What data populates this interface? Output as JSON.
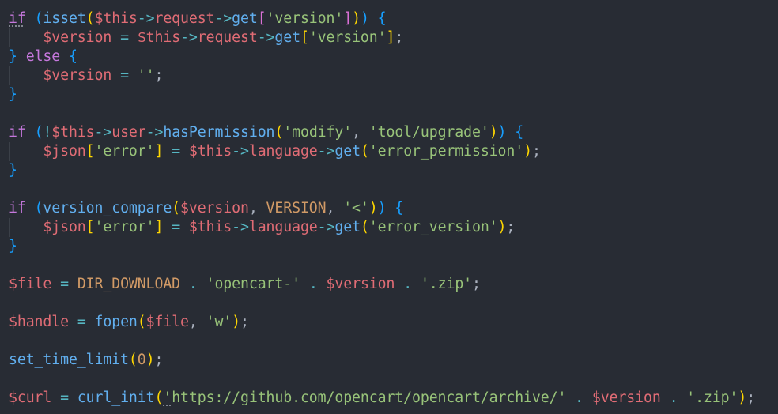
{
  "editor": {
    "language": "php",
    "theme": "dark",
    "colors": {
      "background": "#282c34",
      "keyword": "#c678dd",
      "function": "#61afef",
      "variable": "#e06c75",
      "string": "#98c379",
      "constant": "#d19a66",
      "operator": "#56b6c2",
      "punctuation": "#abb2bf",
      "bracket_level1": "#ffd700",
      "bracket_level2": "#da70d6",
      "bracket_level3": "#179fff"
    },
    "lines": [
      [
        {
          "t": "if",
          "c": "keyword",
          "sq": true
        },
        {
          "t": " ",
          "c": "punct"
        },
        {
          "t": "(",
          "c": "bracket3"
        },
        {
          "t": "isset",
          "c": "function"
        },
        {
          "t": "(",
          "c": "bracket1"
        },
        {
          "t": "$this",
          "c": "variable"
        },
        {
          "t": "->",
          "c": "operator"
        },
        {
          "t": "request",
          "c": "variable"
        },
        {
          "t": "->",
          "c": "operator"
        },
        {
          "t": "get",
          "c": "function"
        },
        {
          "t": "[",
          "c": "bracket2"
        },
        {
          "t": "'version'",
          "c": "string"
        },
        {
          "t": "]",
          "c": "bracket2"
        },
        {
          "t": ")",
          "c": "bracket1"
        },
        {
          "t": ")",
          "c": "bracket3"
        },
        {
          "t": " ",
          "c": "punct"
        },
        {
          "t": "{",
          "c": "bracket3"
        }
      ],
      [
        {
          "t": "    ",
          "c": "punct"
        },
        {
          "t": "$version",
          "c": "variable"
        },
        {
          "t": " ",
          "c": "punct"
        },
        {
          "t": "=",
          "c": "operator"
        },
        {
          "t": " ",
          "c": "punct"
        },
        {
          "t": "$this",
          "c": "variable"
        },
        {
          "t": "->",
          "c": "operator"
        },
        {
          "t": "request",
          "c": "variable"
        },
        {
          "t": "->",
          "c": "operator"
        },
        {
          "t": "get",
          "c": "function"
        },
        {
          "t": "[",
          "c": "bracket1"
        },
        {
          "t": "'version'",
          "c": "string"
        },
        {
          "t": "]",
          "c": "bracket1"
        },
        {
          "t": ";",
          "c": "punct"
        }
      ],
      [
        {
          "t": "}",
          "c": "bracket3"
        },
        {
          "t": " ",
          "c": "punct"
        },
        {
          "t": "else",
          "c": "keyword"
        },
        {
          "t": " ",
          "c": "punct"
        },
        {
          "t": "{",
          "c": "bracket3"
        }
      ],
      [
        {
          "t": "    ",
          "c": "punct"
        },
        {
          "t": "$version",
          "c": "variable"
        },
        {
          "t": " ",
          "c": "punct"
        },
        {
          "t": "=",
          "c": "operator"
        },
        {
          "t": " ",
          "c": "punct"
        },
        {
          "t": "''",
          "c": "string"
        },
        {
          "t": ";",
          "c": "punct"
        }
      ],
      [
        {
          "t": "}",
          "c": "bracket3"
        }
      ],
      [],
      [
        {
          "t": "if",
          "c": "keyword"
        },
        {
          "t": " ",
          "c": "punct"
        },
        {
          "t": "(",
          "c": "bracket3"
        },
        {
          "t": "!",
          "c": "operator"
        },
        {
          "t": "$this",
          "c": "variable"
        },
        {
          "t": "->",
          "c": "operator"
        },
        {
          "t": "user",
          "c": "variable"
        },
        {
          "t": "->",
          "c": "operator"
        },
        {
          "t": "hasPermission",
          "c": "function"
        },
        {
          "t": "(",
          "c": "bracket1"
        },
        {
          "t": "'modify'",
          "c": "string"
        },
        {
          "t": ", ",
          "c": "punct"
        },
        {
          "t": "'tool/upgrade'",
          "c": "string"
        },
        {
          "t": ")",
          "c": "bracket1"
        },
        {
          "t": ")",
          "c": "bracket3"
        },
        {
          "t": " ",
          "c": "punct"
        },
        {
          "t": "{",
          "c": "bracket3"
        }
      ],
      [
        {
          "t": "    ",
          "c": "punct"
        },
        {
          "t": "$json",
          "c": "variable"
        },
        {
          "t": "[",
          "c": "bracket1"
        },
        {
          "t": "'error'",
          "c": "string"
        },
        {
          "t": "]",
          "c": "bracket1"
        },
        {
          "t": " ",
          "c": "punct"
        },
        {
          "t": "=",
          "c": "operator"
        },
        {
          "t": " ",
          "c": "punct"
        },
        {
          "t": "$this",
          "c": "variable"
        },
        {
          "t": "->",
          "c": "operator"
        },
        {
          "t": "language",
          "c": "variable"
        },
        {
          "t": "->",
          "c": "operator"
        },
        {
          "t": "get",
          "c": "function"
        },
        {
          "t": "(",
          "c": "bracket1"
        },
        {
          "t": "'error_permission'",
          "c": "string"
        },
        {
          "t": ")",
          "c": "bracket1"
        },
        {
          "t": ";",
          "c": "punct"
        }
      ],
      [
        {
          "t": "}",
          "c": "bracket3"
        }
      ],
      [],
      [
        {
          "t": "if",
          "c": "keyword"
        },
        {
          "t": " ",
          "c": "punct"
        },
        {
          "t": "(",
          "c": "bracket3"
        },
        {
          "t": "version_compare",
          "c": "function"
        },
        {
          "t": "(",
          "c": "bracket1"
        },
        {
          "t": "$version",
          "c": "variable"
        },
        {
          "t": ", ",
          "c": "punct"
        },
        {
          "t": "VERSION",
          "c": "constant"
        },
        {
          "t": ", ",
          "c": "punct"
        },
        {
          "t": "'<'",
          "c": "string"
        },
        {
          "t": ")",
          "c": "bracket1"
        },
        {
          "t": ")",
          "c": "bracket3"
        },
        {
          "t": " ",
          "c": "punct"
        },
        {
          "t": "{",
          "c": "bracket3"
        }
      ],
      [
        {
          "t": "    ",
          "c": "punct"
        },
        {
          "t": "$json",
          "c": "variable"
        },
        {
          "t": "[",
          "c": "bracket1"
        },
        {
          "t": "'error'",
          "c": "string"
        },
        {
          "t": "]",
          "c": "bracket1"
        },
        {
          "t": " ",
          "c": "punct"
        },
        {
          "t": "=",
          "c": "operator"
        },
        {
          "t": " ",
          "c": "punct"
        },
        {
          "t": "$this",
          "c": "variable"
        },
        {
          "t": "->",
          "c": "operator"
        },
        {
          "t": "language",
          "c": "variable"
        },
        {
          "t": "->",
          "c": "operator"
        },
        {
          "t": "get",
          "c": "function"
        },
        {
          "t": "(",
          "c": "bracket1"
        },
        {
          "t": "'error_version'",
          "c": "string"
        },
        {
          "t": ")",
          "c": "bracket1"
        },
        {
          "t": ";",
          "c": "punct"
        }
      ],
      [
        {
          "t": "}",
          "c": "bracket3"
        }
      ],
      [],
      [
        {
          "t": "$file",
          "c": "variable"
        },
        {
          "t": " ",
          "c": "punct"
        },
        {
          "t": "=",
          "c": "operator"
        },
        {
          "t": " ",
          "c": "punct"
        },
        {
          "t": "DIR_DOWNLOAD",
          "c": "constant"
        },
        {
          "t": " ",
          "c": "punct"
        },
        {
          "t": ".",
          "c": "operator"
        },
        {
          "t": " ",
          "c": "punct"
        },
        {
          "t": "'opencart-'",
          "c": "string"
        },
        {
          "t": " ",
          "c": "punct"
        },
        {
          "t": ".",
          "c": "operator"
        },
        {
          "t": " ",
          "c": "punct"
        },
        {
          "t": "$version",
          "c": "variable"
        },
        {
          "t": " ",
          "c": "punct"
        },
        {
          "t": ".",
          "c": "operator"
        },
        {
          "t": " ",
          "c": "punct"
        },
        {
          "t": "'.zip'",
          "c": "string"
        },
        {
          "t": ";",
          "c": "punct"
        }
      ],
      [],
      [
        {
          "t": "$handle",
          "c": "variable"
        },
        {
          "t": " ",
          "c": "punct"
        },
        {
          "t": "=",
          "c": "operator"
        },
        {
          "t": " ",
          "c": "punct"
        },
        {
          "t": "fopen",
          "c": "function"
        },
        {
          "t": "(",
          "c": "bracket1"
        },
        {
          "t": "$file",
          "c": "variable"
        },
        {
          "t": ", ",
          "c": "punct"
        },
        {
          "t": "'w'",
          "c": "string"
        },
        {
          "t": ")",
          "c": "bracket1"
        },
        {
          "t": ";",
          "c": "punct"
        }
      ],
      [],
      [
        {
          "t": "set_time_limit",
          "c": "function"
        },
        {
          "t": "(",
          "c": "bracket1"
        },
        {
          "t": "0",
          "c": "constant"
        },
        {
          "t": ")",
          "c": "bracket1"
        },
        {
          "t": ";",
          "c": "punct"
        }
      ],
      [],
      [
        {
          "t": "$curl",
          "c": "variable"
        },
        {
          "t": " ",
          "c": "punct"
        },
        {
          "t": "=",
          "c": "operator"
        },
        {
          "t": " ",
          "c": "punct"
        },
        {
          "t": "curl_init",
          "c": "function"
        },
        {
          "t": "(",
          "c": "bracket1"
        },
        {
          "t": "'",
          "c": "string",
          "sq": true
        },
        {
          "t": "https://github.com/opencart/opencart/archive/",
          "c": "url"
        },
        {
          "t": "'",
          "c": "string"
        },
        {
          "t": " ",
          "c": "punct"
        },
        {
          "t": ".",
          "c": "operator"
        },
        {
          "t": " ",
          "c": "punct"
        },
        {
          "t": "$version",
          "c": "variable"
        },
        {
          "t": " ",
          "c": "punct"
        },
        {
          "t": ".",
          "c": "operator"
        },
        {
          "t": " ",
          "c": "punct"
        },
        {
          "t": "'.zip'",
          "c": "string"
        },
        {
          "t": ")",
          "c": "bracket1"
        },
        {
          "t": ";",
          "c": "punct"
        }
      ]
    ]
  }
}
